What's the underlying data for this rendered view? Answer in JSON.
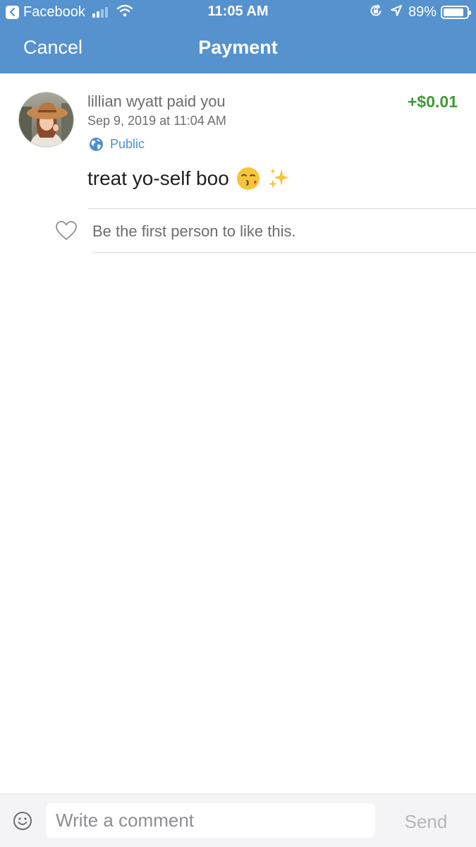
{
  "status_bar": {
    "back_app_label": "Facebook",
    "time": "11:05 AM",
    "battery_percent": "89%",
    "battery_level": 0.89,
    "signal_bars_filled": 2,
    "signal_bars_total": 4
  },
  "nav": {
    "cancel_label": "Cancel",
    "title": "Payment"
  },
  "story": {
    "payer_line": "lillian wyatt paid you",
    "amount": "+$0.01",
    "timestamp": "Sep 9, 2019 at 11:04 AM",
    "audience": "Public",
    "note": "treat yo-self boo"
  },
  "likes": {
    "text": "Be the first person to like this."
  },
  "comment_bar": {
    "placeholder": "Write a comment",
    "send_label": "Send"
  },
  "colors": {
    "nav_blue": "#5592ce",
    "amount_green": "#3d9b35",
    "link_blue": "#4b8fd0"
  },
  "icons": {
    "back": "chevron-left-icon",
    "wifi": "wifi-icon",
    "orientation_lock": "orientation-lock-icon",
    "location": "location-arrow-icon",
    "audience": "globe-icon",
    "like": "heart-icon",
    "emoji": "smiley-icon"
  }
}
